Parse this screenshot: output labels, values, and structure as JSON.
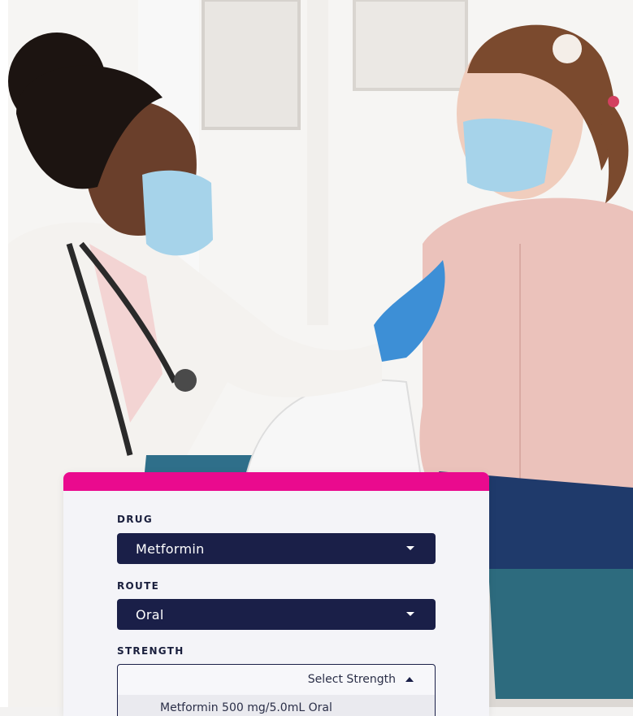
{
  "form": {
    "drug": {
      "label": "DRUG",
      "value": "Metformin"
    },
    "route": {
      "label": "ROUTE",
      "value": "Oral"
    },
    "strength": {
      "label": "STRENGTH",
      "placeholder": "Select Strength",
      "options": [
        "Metformin 500 mg/5.0mL Oral"
      ]
    }
  },
  "colors": {
    "accent": "#ea0a8e",
    "select_bg": "#1a1f48",
    "card_bg": "#f4f4f8"
  }
}
